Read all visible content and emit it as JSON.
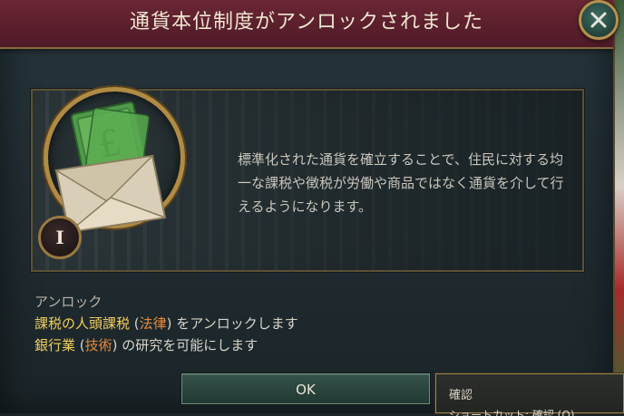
{
  "dialog": {
    "title": "通貨本位制度がアンロックされました",
    "description": "標準化された通貨を確立することで、住民に対する均一な課税や徴税が労働や商品ではなく通貨を介して行えるようになります。",
    "tier": "I",
    "unlock": {
      "heading": "アンロック",
      "items": [
        {
          "name": "課税の人頭課税",
          "category": "法律",
          "suffix": " をアンロックします"
        },
        {
          "name": "銀行業",
          "category": "技術",
          "suffix": " の研究を可能にします"
        }
      ]
    },
    "ok_label": "OK"
  },
  "tooltip": {
    "title": "確認",
    "subtitle": "ショートカット: 確認 (Q)"
  },
  "colors": {
    "title_bar": "#5a1f2d",
    "highlight_name": "#f2cf5b",
    "highlight_category": "#e88a3a",
    "gold_frame": "#b08b43"
  }
}
